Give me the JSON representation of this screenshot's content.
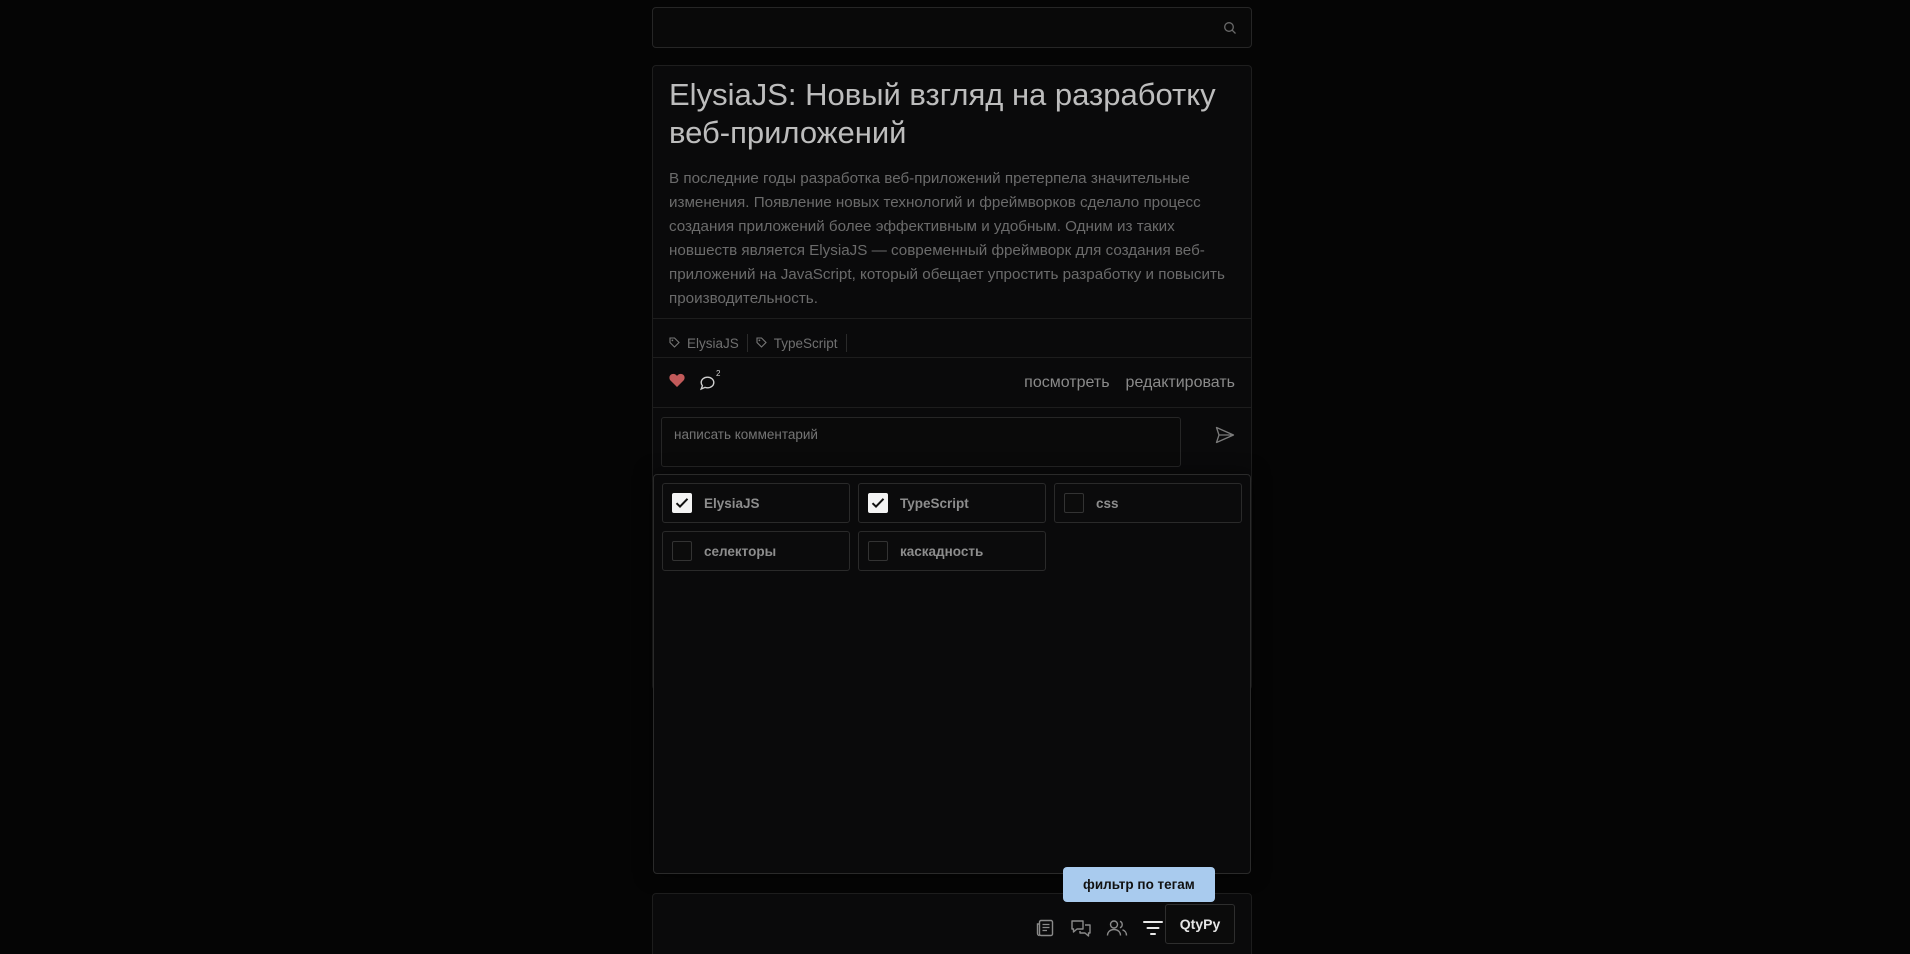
{
  "search": {
    "placeholder": "",
    "icon": "search-icon"
  },
  "post": {
    "title": "ElysiaJS: Новый взгляд на разработку веб-приложений",
    "body": "В последние годы разработка веб-приложений претерпела значительные изменения. Появление новых технологий и фреймворков сделало процесс создания приложений более эффективным и удобным. Одним из таких новшеств является ElysiaJS — современный фреймворк для создания веб-приложений на JavaScript, который обещает упростить разработку и повысить производительность.",
    "tags": [
      {
        "label": "ElysiaJS",
        "icon": "tag-icon"
      },
      {
        "label": "TypeScript",
        "icon": "tag-icon"
      }
    ],
    "liked": true,
    "like_color": "#c25a5a",
    "comments_count": "2",
    "view_label": "посмотреть",
    "edit_label": "редактировать",
    "comment_placeholder": "написать комментарий"
  },
  "tag_filter": {
    "options": [
      {
        "label": "ElysiaJS",
        "checked": true
      },
      {
        "label": "TypeScript",
        "checked": true
      },
      {
        "label": "css",
        "checked": false
      },
      {
        "label": "селекторы",
        "checked": false
      },
      {
        "label": "каскадность",
        "checked": false
      }
    ]
  },
  "tooltip": {
    "text": "фильтр по тегам",
    "color": "#a9cbee"
  },
  "bottom_bar": {
    "icons": [
      "news-icon",
      "chats-icon",
      "users-icon",
      "filter-icon"
    ],
    "brand": "QtyPy"
  }
}
